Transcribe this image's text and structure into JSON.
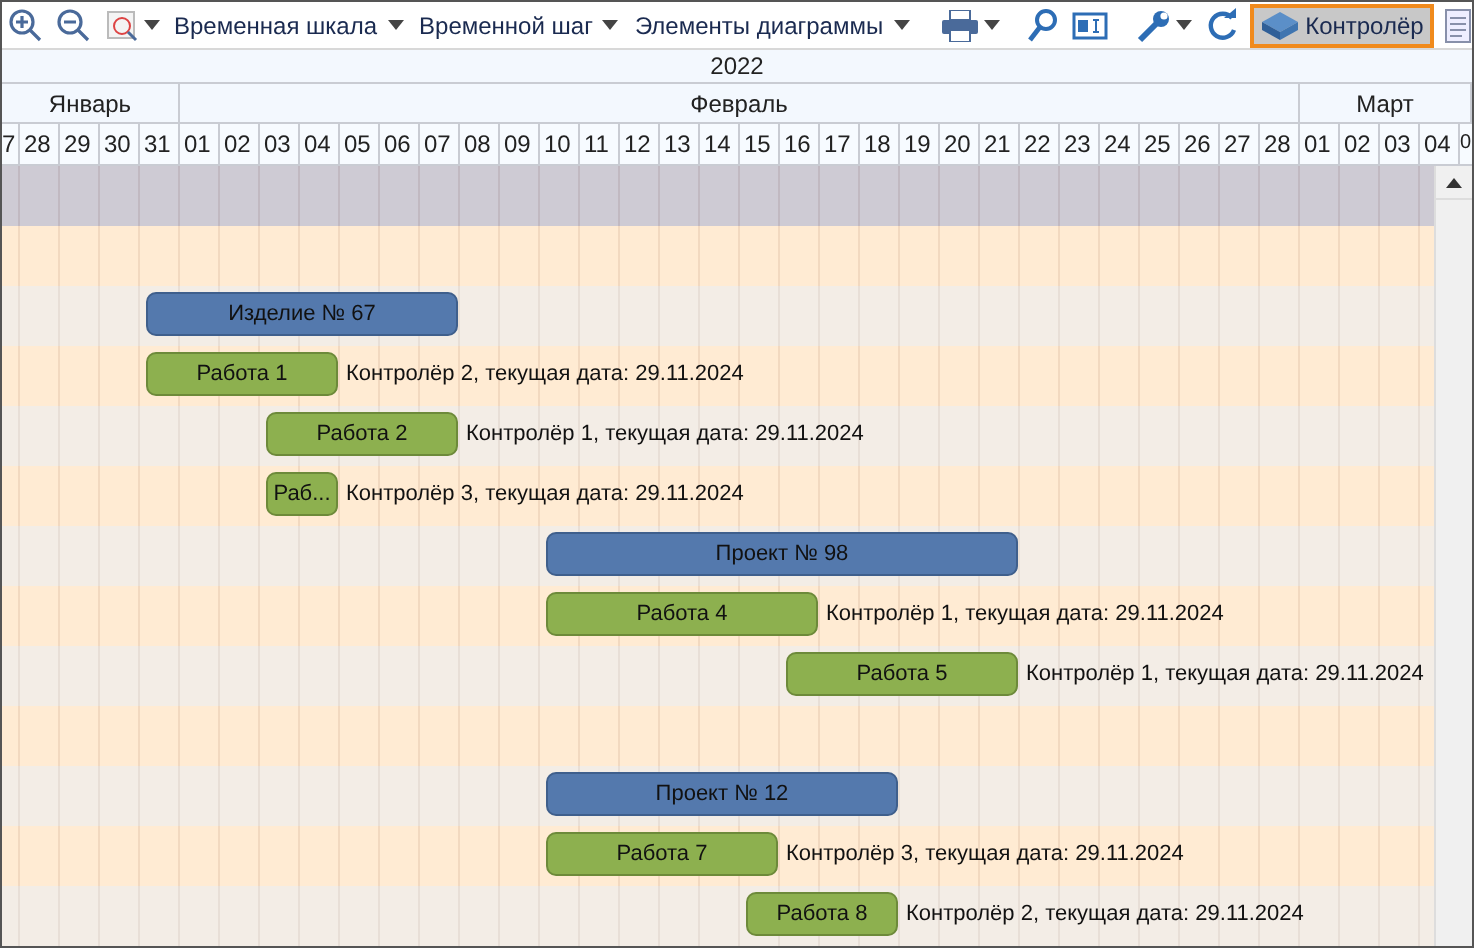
{
  "toolbar": {
    "dropdowns": [
      {
        "label": "Временная шкала"
      },
      {
        "label": "Временной шаг"
      },
      {
        "label": "Элементы диаграммы"
      }
    ],
    "controller_button": {
      "label": "Контролёр",
      "selected": true
    }
  },
  "timeline": {
    "year": "2022",
    "months": [
      {
        "label": "Январь",
        "days": [
          "7",
          "28",
          "29",
          "30",
          "31"
        ]
      },
      {
        "label": "Февраль",
        "days": [
          "01",
          "02",
          "03",
          "04",
          "05",
          "06",
          "07",
          "08",
          "09",
          "10",
          "11",
          "12",
          "13",
          "14",
          "15",
          "16",
          "17",
          "18",
          "19",
          "20",
          "21",
          "22",
          "23",
          "24",
          "25",
          "26",
          "27",
          "28"
        ]
      },
      {
        "label": "Март",
        "days": [
          "01",
          "02",
          "03",
          "04",
          "0"
        ]
      }
    ]
  },
  "rows": [
    {
      "kind": "empty"
    },
    {
      "kind": "summary",
      "label": "Изделие № 67"
    },
    {
      "kind": "task",
      "label": "Работа 1",
      "note": "Контролёр 2, текущая дата: 29.11.2024"
    },
    {
      "kind": "task",
      "label": "Работа 2",
      "note": "Контролёр 1, текущая дата: 29.11.2024"
    },
    {
      "kind": "task",
      "label": "Раб...",
      "note": "Контролёр 3, текущая дата: 29.11.2024"
    },
    {
      "kind": "summary",
      "label": "Проект № 98"
    },
    {
      "kind": "task",
      "label": "Работа 4",
      "note": "Контролёр 1, текущая дата: 29.11.2024"
    },
    {
      "kind": "task",
      "label": "Работа 5",
      "note": "Контролёр 1, текущая дата: 29.11.2024"
    },
    {
      "kind": "empty"
    },
    {
      "kind": "summary",
      "label": "Проект № 12"
    },
    {
      "kind": "task",
      "label": "Работа 7",
      "note": "Контролёр 3, текущая дата: 29.11.2024"
    },
    {
      "kind": "task",
      "label": "Работа 8",
      "note": "Контролёр 2, текущая дата: 29.11.2024"
    }
  ]
}
